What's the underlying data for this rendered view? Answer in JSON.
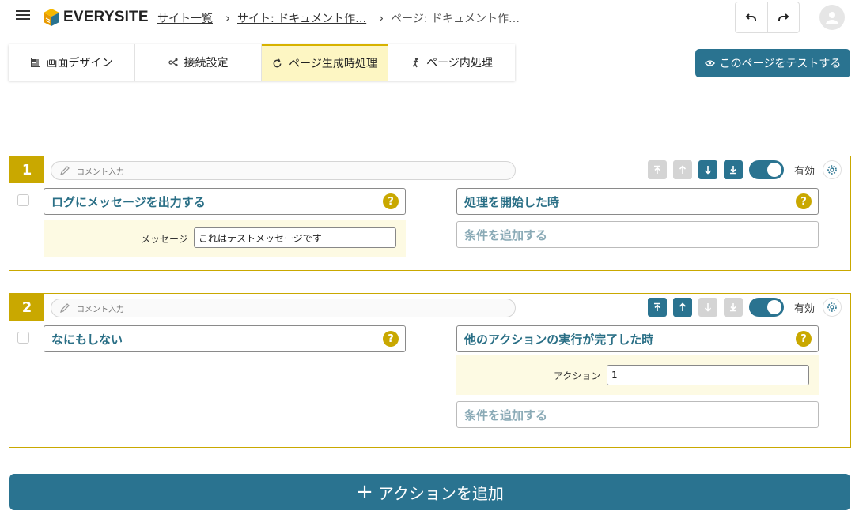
{
  "header": {
    "logo_text": "EVERYSITE",
    "breadcrumbs": [
      "サイト一覧",
      "サイト: ドキュメント作…",
      "ページ: ドキュメント作…"
    ]
  },
  "tabs": [
    {
      "label": "画面デザイン",
      "icon": "layout-icon"
    },
    {
      "label": "接続設定",
      "icon": "connection-icon"
    },
    {
      "label": "ページ生成時処理",
      "icon": "refresh-icon",
      "active": true
    },
    {
      "label": "ページ内処理",
      "icon": "runner-icon"
    }
  ],
  "test_button": "このページをテストする",
  "actions": [
    {
      "number": "1",
      "comment_placeholder": "コメント入力",
      "enabled_label": "有効",
      "action_name": "ログにメッセージを出力する",
      "trigger": "処理を開始した時",
      "param_label": "メッセージ",
      "param_value": "これはテストメッセージです",
      "add_condition": "条件を追加する"
    },
    {
      "number": "2",
      "comment_placeholder": "コメント入力",
      "enabled_label": "有効",
      "action_name": "なにもしない",
      "trigger": "他のアクションの実行が完了した時",
      "param_label": "アクション",
      "param_value": "1",
      "add_condition": "条件を追加する"
    }
  ],
  "help_glyph": "?",
  "add_action": {
    "plus": "+",
    "label": "アクションを追加"
  },
  "colors": {
    "primary": "#2a7390",
    "accent": "#c9a800",
    "tab_active_bg": "#fdf6c3",
    "param_bg": "#fdfae3"
  }
}
